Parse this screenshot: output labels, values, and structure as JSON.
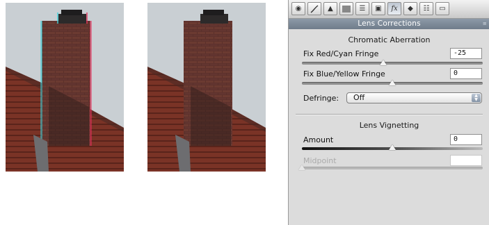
{
  "colors": {
    "panel_bg": "#dcdcdc",
    "title_bar": "#7a8794",
    "field_border": "#8e8e8e",
    "photo_sky": "#c9cfd3",
    "brick": "#5e332c"
  },
  "photos": {
    "before": {
      "name": "chimney-before",
      "note": "red/cyan fringing visible"
    },
    "after": {
      "name": "chimney-after"
    }
  },
  "toolbar": {
    "icons": [
      "camera-calibration-icon",
      "tone-curve-icon",
      "hsl-icon",
      "grayscale-icon",
      "split-toning-icon",
      "detail-icon",
      "lens-fx-icon",
      "effects-icon",
      "presets-icon",
      "snapshots-icon"
    ],
    "fx_glyph": "fx"
  },
  "panel": {
    "title": "Lens Corrections",
    "chromatic": {
      "title": "Chromatic Aberration",
      "red_cyan": {
        "label": "Fix Red/Cyan Fringe",
        "value": "-25",
        "position": 0.45
      },
      "blue_yellow": {
        "label": "Fix Blue/Yellow Fringe",
        "value": "0",
        "position": 0.5
      },
      "defringe": {
        "label": "Defringe:",
        "selected": "Off"
      }
    },
    "vignetting": {
      "title": "Lens Vignetting",
      "amount": {
        "label": "Amount",
        "value": "0",
        "position": 0.5
      },
      "midpoint": {
        "label": "Midpoint",
        "value": "",
        "position": 0.0,
        "disabled": true
      }
    }
  }
}
